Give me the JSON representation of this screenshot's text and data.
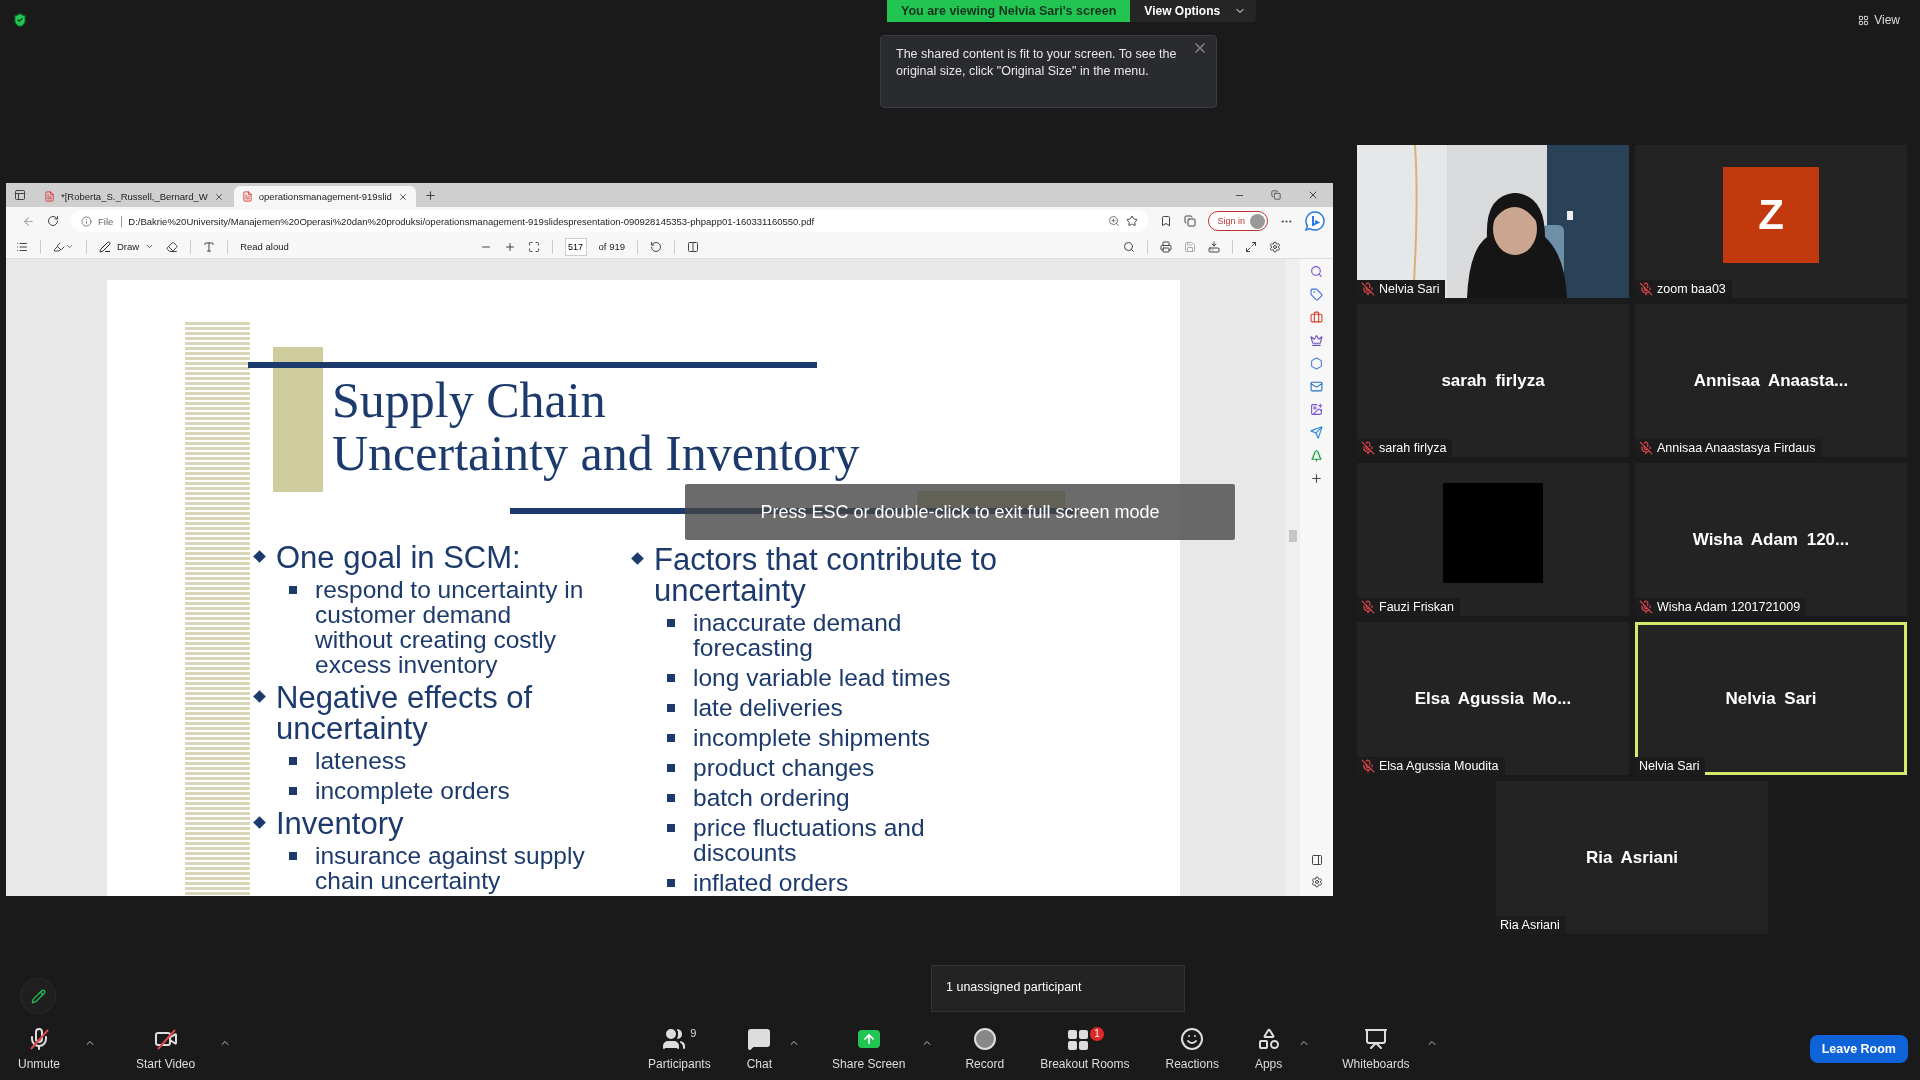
{
  "share_banner": {
    "text": "You are viewing Nelvia Sari's screen",
    "options": "View Options"
  },
  "tooltip": {
    "text": "The shared content is fit to your screen. To see the original size, click \"Original Size\" in the menu."
  },
  "view_button": "View",
  "browser": {
    "tabs": [
      {
        "label": "*[Roberta_S._Russell,_Bernard_W",
        "selected": false
      },
      {
        "label": "operationsmanagement-919slid",
        "selected": true
      }
    ],
    "address": {
      "scheme": "File",
      "url": "D:/Bakrie%20University/Manajemen%20Operasi%20dan%20produksi/operationsmanagement-919slidespresentation-090928145353-phpapp01-160331160550.pdf"
    },
    "sign_in": "Sign in",
    "pdf_toolbar": {
      "draw": "Draw",
      "read_aloud": "Read aloud",
      "page": "517",
      "page_total": "of 919"
    }
  },
  "slide": {
    "title_lines": [
      "Supply Chain",
      "Uncertainty and Inventory"
    ],
    "columns": [
      [
        {
          "text": "One goal in SCM:",
          "children": [
            "respond to uncertainty in customer demand without creating costly excess inventory"
          ]
        },
        {
          "text": "Negative effects of uncertainty",
          "children": [
            "lateness",
            "incomplete orders"
          ]
        },
        {
          "text": "Inventory",
          "children": [
            "insurance against supply chain uncertainty"
          ]
        }
      ],
      [
        {
          "text": "Factors that contribute to uncertainty",
          "children": [
            "inaccurate demand forecasting",
            "long variable lead times",
            "late deliveries",
            "incomplete shipments",
            "product changes",
            "batch ordering",
            "price fluctuations and discounts",
            "inflated orders"
          ]
        }
      ]
    ]
  },
  "fullscreen_notice": "Press ESC or double-click to exit full screen mode",
  "participants": [
    {
      "kind": "video",
      "label": "Nelvia Sari",
      "muted": true,
      "active": false
    },
    {
      "kind": "avatar",
      "initial": "Z",
      "label": "zoom baa03",
      "muted": true,
      "active": false
    },
    {
      "kind": "name",
      "name": "sarah firlyza",
      "label": "sarah firlyza",
      "muted": true,
      "active": false
    },
    {
      "kind": "name",
      "name": "Annisaa Anaasta...",
      "label": "Annisaa Anaastasya Firdaus",
      "muted": true,
      "active": false
    },
    {
      "kind": "blank",
      "label": "Fauzi Friskan",
      "muted": true,
      "active": false
    },
    {
      "kind": "name",
      "name": "Wisha Adam 120...",
      "label": "Wisha Adam 1201721009",
      "muted": true,
      "active": false
    },
    {
      "kind": "name",
      "name": "Elsa Agussia Mo...",
      "label": "Elsa Agussia Moudita",
      "muted": true,
      "active": false
    },
    {
      "kind": "name",
      "name": "Nelvia Sari",
      "label": "Nelvia Sari",
      "muted": false,
      "active": true
    },
    {
      "kind": "name",
      "name": "Ria Asriani",
      "label": "Ria Asriani",
      "muted": false,
      "active": false
    }
  ],
  "unassigned_tooltip": "1 unassigned participant",
  "toolbar": {
    "left": [
      {
        "kind": "mic",
        "label": "Unmute",
        "off": true,
        "caret": true
      },
      {
        "kind": "video",
        "label": "Start Video",
        "off": true,
        "caret": true
      }
    ],
    "center": [
      {
        "kind": "participants",
        "label": "Participants",
        "count": "9",
        "caret": false
      },
      {
        "kind": "chat",
        "label": "Chat",
        "caret": true
      },
      {
        "kind": "share",
        "label": "Share Screen",
        "caret": true
      },
      {
        "kind": "record",
        "label": "Record",
        "caret": false
      },
      {
        "kind": "breakout",
        "label": "Breakout Rooms",
        "badge": "1",
        "caret": false
      },
      {
        "kind": "reactions",
        "label": "Reactions",
        "caret": false
      },
      {
        "kind": "apps",
        "label": "Apps",
        "caret": true
      },
      {
        "kind": "whiteboards",
        "label": "Whiteboards",
        "caret": true
      }
    ],
    "leave": "Leave Room"
  }
}
